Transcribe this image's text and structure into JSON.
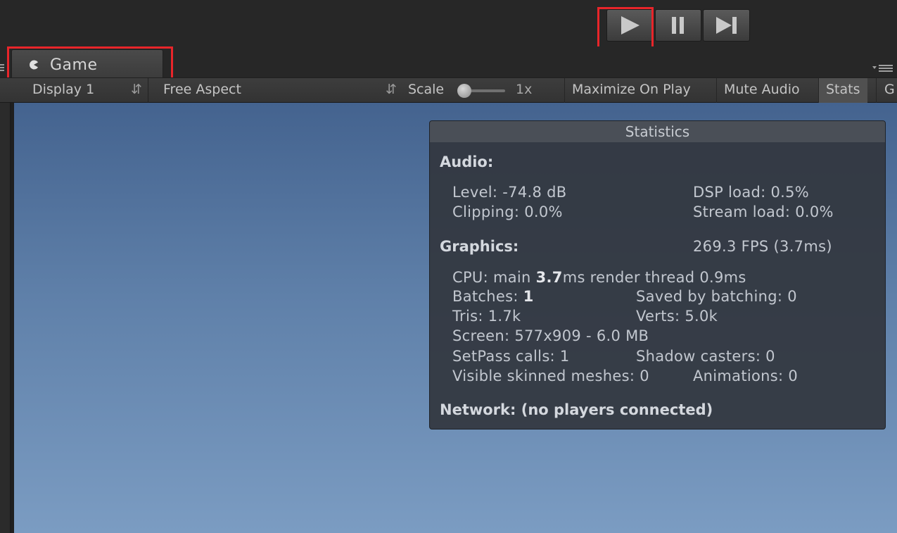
{
  "play_controls": {
    "play": "play-icon",
    "pause": "pause-icon",
    "step": "step-icon"
  },
  "tab": {
    "label": "Game",
    "icon": "pacman-icon"
  },
  "toolbar": {
    "display": "Display 1",
    "aspect": "Free Aspect",
    "scale_label": "Scale",
    "scale_value": "1x",
    "maximize_on_play": "Maximize On Play",
    "mute_audio": "Mute Audio",
    "stats": "Stats",
    "gizmos": "G"
  },
  "stats": {
    "title": "Statistics",
    "audio": {
      "header": "Audio:",
      "level": "Level: -74.8 dB",
      "dsp_load": "DSP load: 0.5%",
      "clipping": "Clipping: 0.0%",
      "stream_load": "Stream load: 0.0%"
    },
    "graphics": {
      "header": "Graphics:",
      "fps": "269.3 FPS (3.7ms)",
      "cpu_label": "CPU: main ",
      "cpu_main": "3.7",
      "cpu_rest": "ms  render thread 0.9ms",
      "batches_label": "Batches: ",
      "batches": "1",
      "saved_by_batching": "Saved by batching: 0",
      "tris": "Tris: 1.7k",
      "verts": "Verts: 5.0k",
      "screen": "Screen: 577x909 - 6.0 MB",
      "setpass": "SetPass calls: 1",
      "shadow_casters": "Shadow casters: 0",
      "skinned": "Visible skinned meshes: 0",
      "animations": "Animations: 0"
    },
    "network": "Network: (no players connected)"
  },
  "colors": {
    "highlight": "#e8252a",
    "game_bg_top": "#44638f",
    "game_bg_bottom": "#7b9cc2"
  }
}
